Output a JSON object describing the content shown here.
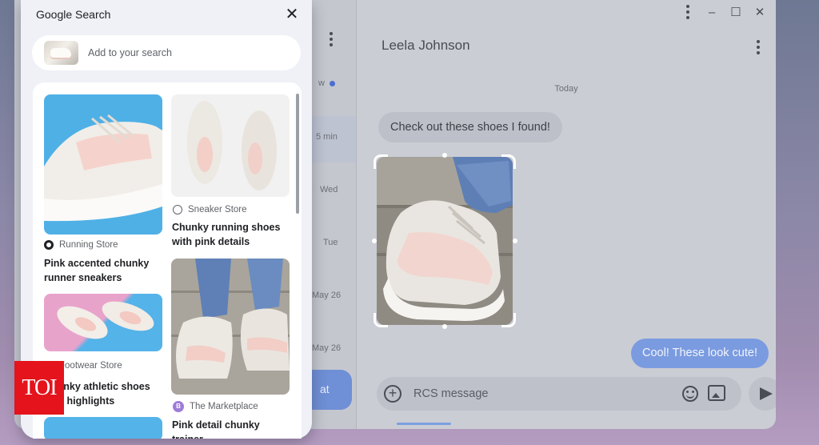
{
  "messages_app": {
    "contact_name": "Leela Johnson",
    "date_separator": "Today",
    "incoming_message": "Check out these shoes I found!",
    "outgoing_message": "Cool! These look cute!",
    "composer_placeholder": "RCS message",
    "start_chat_fab_partial": "at",
    "conversation_list_visible_fragments": {
      "unread_label_partial": "w",
      "times": [
        "5 min",
        "Wed",
        "Tue",
        "May 26",
        "May 26"
      ]
    },
    "accent_color": "#7b9be0"
  },
  "google_search_panel": {
    "title": "Google Search",
    "add_to_search_label": "Add to your search",
    "results": [
      {
        "source": "Running Store",
        "title": "Pink accented chunky runner sneakers",
        "selected": true
      },
      {
        "source": "Sneaker Store",
        "title": "Chunky running shoes with pink details",
        "selected": false
      },
      {
        "source": "Footwear Store",
        "title": "Chunky athletic shoes with highlights",
        "selected": false
      },
      {
        "source": "The Marketplace",
        "title": "Pink detail chunky trainer",
        "selected": false,
        "source_badge": "B"
      }
    ]
  },
  "watermark": {
    "text": "TOI",
    "color": "#e4131c"
  }
}
